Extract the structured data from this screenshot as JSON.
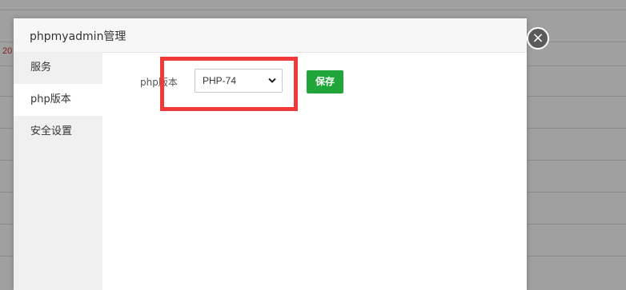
{
  "background": {
    "row_text": "20"
  },
  "modal": {
    "title": "phpmyadmin管理",
    "close_icon": "close-icon",
    "sidebar": {
      "items": [
        {
          "label": "服务",
          "active": false
        },
        {
          "label": "php版本",
          "active": true
        },
        {
          "label": "安全设置",
          "active": false
        }
      ]
    },
    "php_version": {
      "label": "php版本",
      "selected": "PHP-74",
      "chevron_icon": "chevron-down-icon"
    },
    "save_label": "保存",
    "colors": {
      "save_button": "#20a53a",
      "highlight_box": "#f03a3a"
    }
  }
}
